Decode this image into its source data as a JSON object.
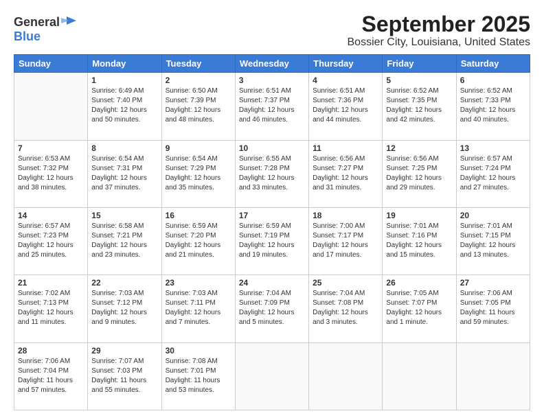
{
  "logo": {
    "general": "General",
    "blue": "Blue"
  },
  "header": {
    "month": "September 2025",
    "location": "Bossier City, Louisiana, United States"
  },
  "weekdays": [
    "Sunday",
    "Monday",
    "Tuesday",
    "Wednesday",
    "Thursday",
    "Friday",
    "Saturday"
  ],
  "weeks": [
    [
      {
        "day": "",
        "sunrise": "",
        "sunset": "",
        "daylight": ""
      },
      {
        "day": "1",
        "sunrise": "Sunrise: 6:49 AM",
        "sunset": "Sunset: 7:40 PM",
        "daylight": "Daylight: 12 hours and 50 minutes."
      },
      {
        "day": "2",
        "sunrise": "Sunrise: 6:50 AM",
        "sunset": "Sunset: 7:39 PM",
        "daylight": "Daylight: 12 hours and 48 minutes."
      },
      {
        "day": "3",
        "sunrise": "Sunrise: 6:51 AM",
        "sunset": "Sunset: 7:37 PM",
        "daylight": "Daylight: 12 hours and 46 minutes."
      },
      {
        "day": "4",
        "sunrise": "Sunrise: 6:51 AM",
        "sunset": "Sunset: 7:36 PM",
        "daylight": "Daylight: 12 hours and 44 minutes."
      },
      {
        "day": "5",
        "sunrise": "Sunrise: 6:52 AM",
        "sunset": "Sunset: 7:35 PM",
        "daylight": "Daylight: 12 hours and 42 minutes."
      },
      {
        "day": "6",
        "sunrise": "Sunrise: 6:52 AM",
        "sunset": "Sunset: 7:33 PM",
        "daylight": "Daylight: 12 hours and 40 minutes."
      }
    ],
    [
      {
        "day": "7",
        "sunrise": "Sunrise: 6:53 AM",
        "sunset": "Sunset: 7:32 PM",
        "daylight": "Daylight: 12 hours and 38 minutes."
      },
      {
        "day": "8",
        "sunrise": "Sunrise: 6:54 AM",
        "sunset": "Sunset: 7:31 PM",
        "daylight": "Daylight: 12 hours and 37 minutes."
      },
      {
        "day": "9",
        "sunrise": "Sunrise: 6:54 AM",
        "sunset": "Sunset: 7:29 PM",
        "daylight": "Daylight: 12 hours and 35 minutes."
      },
      {
        "day": "10",
        "sunrise": "Sunrise: 6:55 AM",
        "sunset": "Sunset: 7:28 PM",
        "daylight": "Daylight: 12 hours and 33 minutes."
      },
      {
        "day": "11",
        "sunrise": "Sunrise: 6:56 AM",
        "sunset": "Sunset: 7:27 PM",
        "daylight": "Daylight: 12 hours and 31 minutes."
      },
      {
        "day": "12",
        "sunrise": "Sunrise: 6:56 AM",
        "sunset": "Sunset: 7:25 PM",
        "daylight": "Daylight: 12 hours and 29 minutes."
      },
      {
        "day": "13",
        "sunrise": "Sunrise: 6:57 AM",
        "sunset": "Sunset: 7:24 PM",
        "daylight": "Daylight: 12 hours and 27 minutes."
      }
    ],
    [
      {
        "day": "14",
        "sunrise": "Sunrise: 6:57 AM",
        "sunset": "Sunset: 7:23 PM",
        "daylight": "Daylight: 12 hours and 25 minutes."
      },
      {
        "day": "15",
        "sunrise": "Sunrise: 6:58 AM",
        "sunset": "Sunset: 7:21 PM",
        "daylight": "Daylight: 12 hours and 23 minutes."
      },
      {
        "day": "16",
        "sunrise": "Sunrise: 6:59 AM",
        "sunset": "Sunset: 7:20 PM",
        "daylight": "Daylight: 12 hours and 21 minutes."
      },
      {
        "day": "17",
        "sunrise": "Sunrise: 6:59 AM",
        "sunset": "Sunset: 7:19 PM",
        "daylight": "Daylight: 12 hours and 19 minutes."
      },
      {
        "day": "18",
        "sunrise": "Sunrise: 7:00 AM",
        "sunset": "Sunset: 7:17 PM",
        "daylight": "Daylight: 12 hours and 17 minutes."
      },
      {
        "day": "19",
        "sunrise": "Sunrise: 7:01 AM",
        "sunset": "Sunset: 7:16 PM",
        "daylight": "Daylight: 12 hours and 15 minutes."
      },
      {
        "day": "20",
        "sunrise": "Sunrise: 7:01 AM",
        "sunset": "Sunset: 7:15 PM",
        "daylight": "Daylight: 12 hours and 13 minutes."
      }
    ],
    [
      {
        "day": "21",
        "sunrise": "Sunrise: 7:02 AM",
        "sunset": "Sunset: 7:13 PM",
        "daylight": "Daylight: 12 hours and 11 minutes."
      },
      {
        "day": "22",
        "sunrise": "Sunrise: 7:03 AM",
        "sunset": "Sunset: 7:12 PM",
        "daylight": "Daylight: 12 hours and 9 minutes."
      },
      {
        "day": "23",
        "sunrise": "Sunrise: 7:03 AM",
        "sunset": "Sunset: 7:11 PM",
        "daylight": "Daylight: 12 hours and 7 minutes."
      },
      {
        "day": "24",
        "sunrise": "Sunrise: 7:04 AM",
        "sunset": "Sunset: 7:09 PM",
        "daylight": "Daylight: 12 hours and 5 minutes."
      },
      {
        "day": "25",
        "sunrise": "Sunrise: 7:04 AM",
        "sunset": "Sunset: 7:08 PM",
        "daylight": "Daylight: 12 hours and 3 minutes."
      },
      {
        "day": "26",
        "sunrise": "Sunrise: 7:05 AM",
        "sunset": "Sunset: 7:07 PM",
        "daylight": "Daylight: 12 hours and 1 minute."
      },
      {
        "day": "27",
        "sunrise": "Sunrise: 7:06 AM",
        "sunset": "Sunset: 7:05 PM",
        "daylight": "Daylight: 11 hours and 59 minutes."
      }
    ],
    [
      {
        "day": "28",
        "sunrise": "Sunrise: 7:06 AM",
        "sunset": "Sunset: 7:04 PM",
        "daylight": "Daylight: 11 hours and 57 minutes."
      },
      {
        "day": "29",
        "sunrise": "Sunrise: 7:07 AM",
        "sunset": "Sunset: 7:03 PM",
        "daylight": "Daylight: 11 hours and 55 minutes."
      },
      {
        "day": "30",
        "sunrise": "Sunrise: 7:08 AM",
        "sunset": "Sunset: 7:01 PM",
        "daylight": "Daylight: 11 hours and 53 minutes."
      },
      {
        "day": "",
        "sunrise": "",
        "sunset": "",
        "daylight": ""
      },
      {
        "day": "",
        "sunrise": "",
        "sunset": "",
        "daylight": ""
      },
      {
        "day": "",
        "sunrise": "",
        "sunset": "",
        "daylight": ""
      },
      {
        "day": "",
        "sunrise": "",
        "sunset": "",
        "daylight": ""
      }
    ]
  ]
}
